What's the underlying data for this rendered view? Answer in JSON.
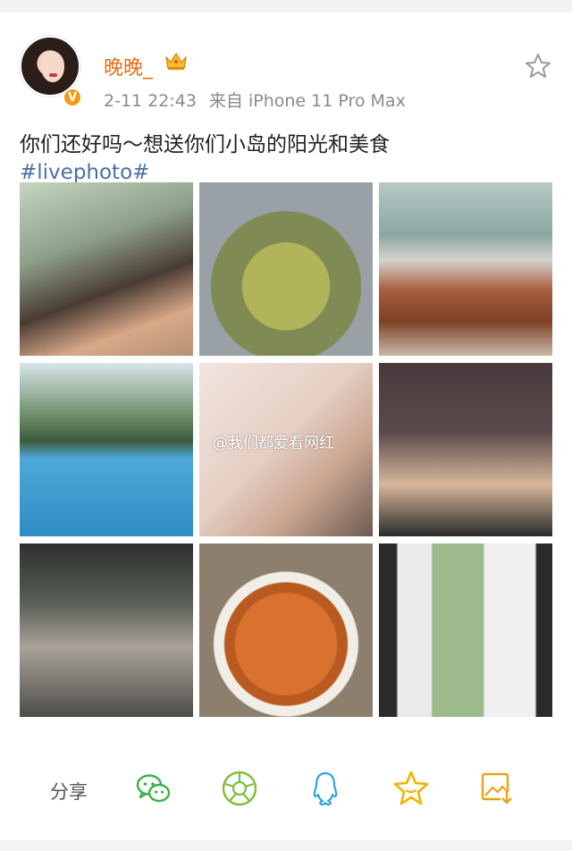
{
  "post": {
    "username": "晚晚_",
    "timestamp": "2-11 22:43",
    "source": "来自 iPhone 11 Pro Max",
    "text": "你们还好吗～想送你们小岛的阳光和美食",
    "hashtag": "#livephoto#",
    "verified_badge": "V"
  },
  "watermark": "@我们都爱看网红",
  "share": {
    "label": "分享",
    "targets": [
      "wechat-icon",
      "moments-icon",
      "qq-icon",
      "favorites-star-icon",
      "save-image-icon"
    ]
  },
  "colors": {
    "username": "#e86c14",
    "hashtag": "#4a6fa5",
    "wechat": "#3cb14a",
    "moments": "#7bbf3a",
    "qq": "#2aa7e0",
    "favorites": "#f2b400",
    "save": "#e8a317"
  }
}
